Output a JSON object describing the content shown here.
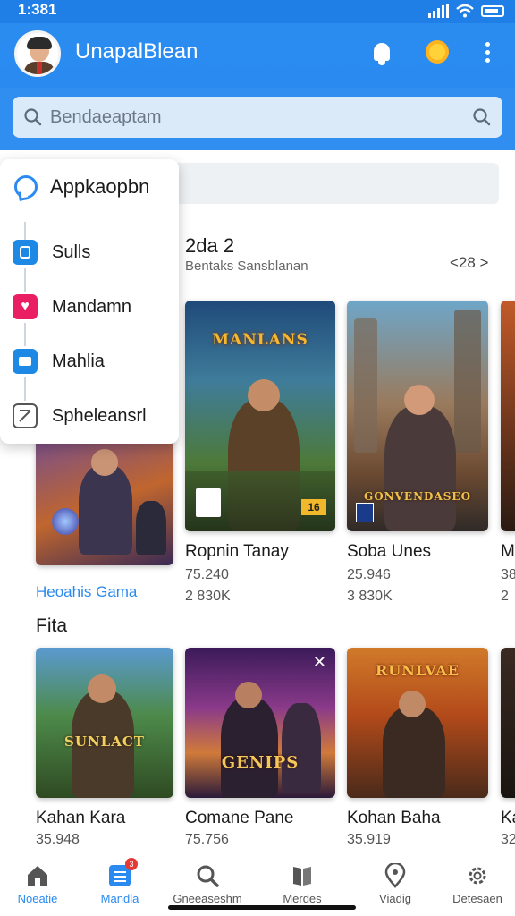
{
  "status": {
    "time": "1:381"
  },
  "header": {
    "title": "UnapalBlean"
  },
  "search": {
    "placeholder": "Bendaeaptam"
  },
  "menu": {
    "title": "Appkaopbn",
    "items": [
      {
        "label": "Sulls",
        "icon": "square-icon",
        "color": "#1e88e5"
      },
      {
        "label": "Mandamn",
        "icon": "heart-check-icon",
        "color": "#e91e63"
      },
      {
        "label": "Mahlia",
        "icon": "toolbox-icon",
        "color": "#1e88e5"
      },
      {
        "label": "Spheleansrl",
        "icon": "chart-icon",
        "color": "#555555"
      }
    ]
  },
  "section1": {
    "title": "2da 2",
    "subtitle": "Bentaks Sansblanan",
    "nav": "<28 >",
    "cards": [
      {
        "title": "Ropnin Tanay",
        "line1": "75.240",
        "line2": "2 830K",
        "logo": "MANLANS",
        "badge": "16"
      },
      {
        "title": "Soba Unes",
        "line1": "25.946",
        "line2": "3 830K",
        "logo": "GONVENDASEO",
        "badge": ""
      },
      {
        "title": "M",
        "line1": "38",
        "line2": "2",
        "logo": "",
        "badge": ""
      }
    ],
    "side_card": {
      "link": "Heoahis Gama"
    }
  },
  "section2": {
    "title": "Fita",
    "cards": [
      {
        "title": "Kahan Kara",
        "line1": "35.948",
        "logo": "SUNLACT"
      },
      {
        "title": "Comane Pane",
        "line1": "75.756",
        "logo": "GENIPS"
      },
      {
        "title": "Kohan Baha",
        "line1": "35.919",
        "logo": "RUNLVAE"
      },
      {
        "title": "Ka",
        "line1": "32",
        "logo": ""
      }
    ]
  },
  "bottom_nav": [
    {
      "label": "Noeatie",
      "icon": "home-icon",
      "active": false
    },
    {
      "label": "Mandla",
      "icon": "list-icon",
      "active": true,
      "badge": "3"
    },
    {
      "label": "Gneeaseshm",
      "icon": "search-icon",
      "active": false
    },
    {
      "label": "Merdes",
      "icon": "book-icon",
      "active": false
    },
    {
      "label": "Viadig",
      "icon": "location-icon",
      "active": false
    },
    {
      "label": "Detesaen",
      "icon": "gear-icon",
      "active": false
    }
  ],
  "colors": {
    "primary": "#2a8af0",
    "accent_red": "#e53935"
  }
}
